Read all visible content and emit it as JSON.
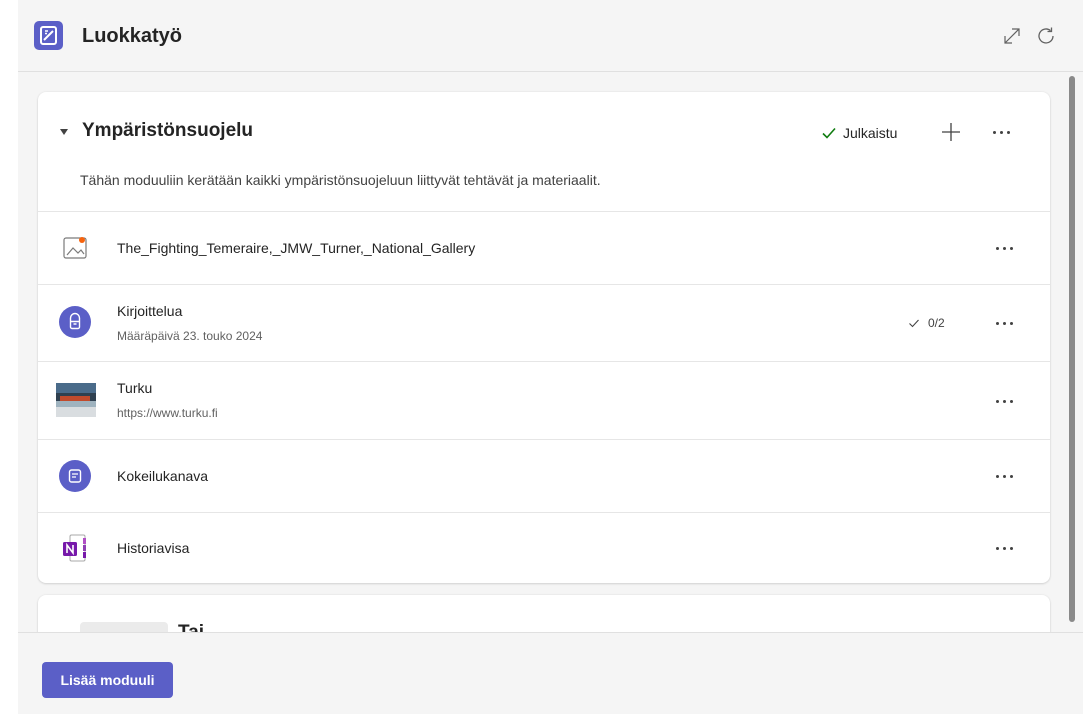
{
  "header": {
    "title": "Luokkatyö",
    "icons": {
      "app": "assignment-app-icon",
      "expand": "expand-icon",
      "refresh": "refresh-icon"
    }
  },
  "module": {
    "title": "Ympäristönsuojelu",
    "status": "Julkaistu",
    "description": "Tähän moduuliin kerätään kaikki ympäristönsuojeluun liittyvät tehtävät ja materiaalit.",
    "items": [
      {
        "name": "The_Fighting_Temeraire,_JMW_Turner,_National_Gallery",
        "icon": "image-file-icon"
      },
      {
        "name": "Kirjoittelua",
        "sub": "Määräpäivä 23. touko 2024",
        "count": "0/2",
        "icon": "assignment-icon"
      },
      {
        "name": "Turku",
        "sub": "https://www.turku.fi",
        "icon": "link-thumbnail"
      },
      {
        "name": "Kokeilukanava",
        "icon": "channel-icon"
      },
      {
        "name": "Historiavisa",
        "icon": "onenote-icon"
      }
    ]
  },
  "module2": {
    "title": "Tai"
  },
  "footer": {
    "add_module_label": "Lisää moduuli"
  },
  "colors": {
    "accent": "#5b5fc7",
    "success": "#107c10",
    "onenote": "#7719aa"
  }
}
